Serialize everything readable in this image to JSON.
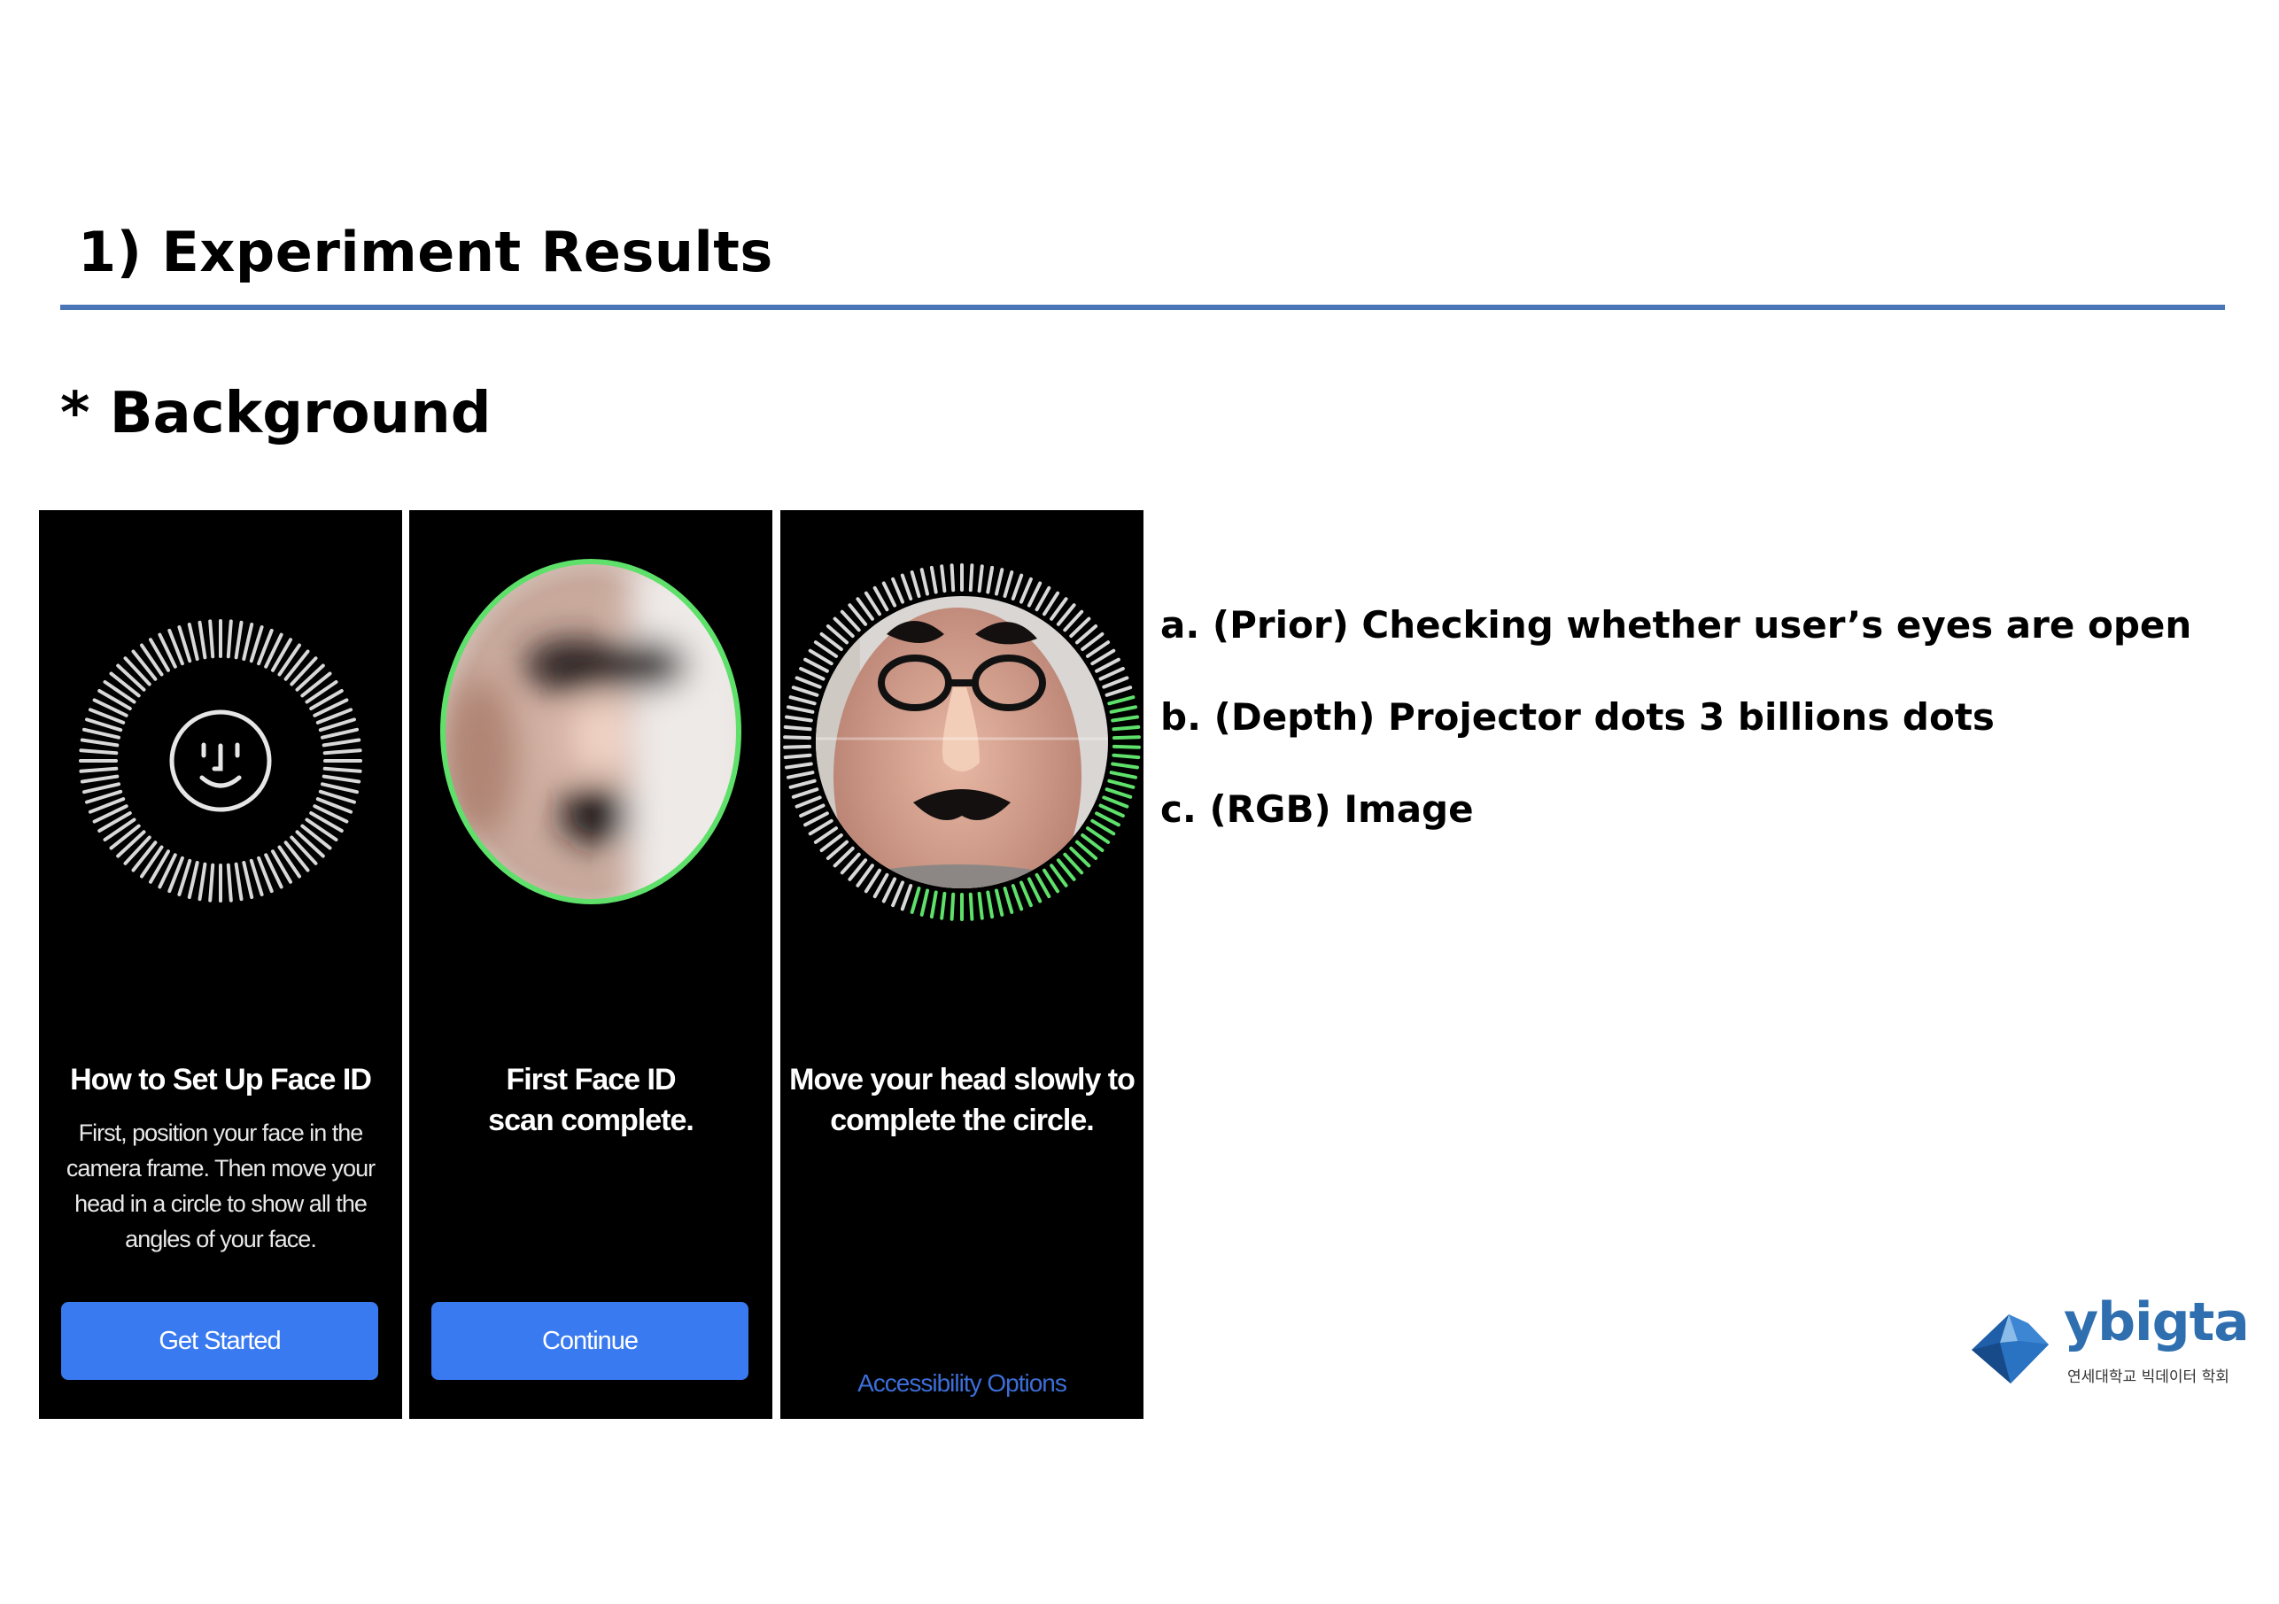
{
  "slide": {
    "title": "1) Experiment Results",
    "section": "* Background",
    "bullets": [
      "a. (Prior) Checking whether user’s eyes are open",
      "b. (Depth) Projector dots 3 billions dots",
      "c. (RGB) Image"
    ]
  },
  "phones": [
    {
      "title": "How to Set Up Face ID",
      "body": "First, position your face in the camera frame. Then move your head in a circle to show all the angles of your face.",
      "button": "Get Started"
    },
    {
      "title_line1": "First Face ID",
      "title_line2": "scan complete.",
      "button": "Continue"
    },
    {
      "title_line1": "Move your head slowly to",
      "title_line2": "complete the circle.",
      "link": "Accessibility Options"
    }
  ],
  "logo": {
    "word": "ybigta",
    "subtitle": "연세대학교 빅데이터 학회"
  },
  "colors": {
    "rule": "#4a76b8",
    "button": "#3a7af0",
    "progress": "#5ee06a",
    "logo": "#2f6fb0"
  }
}
